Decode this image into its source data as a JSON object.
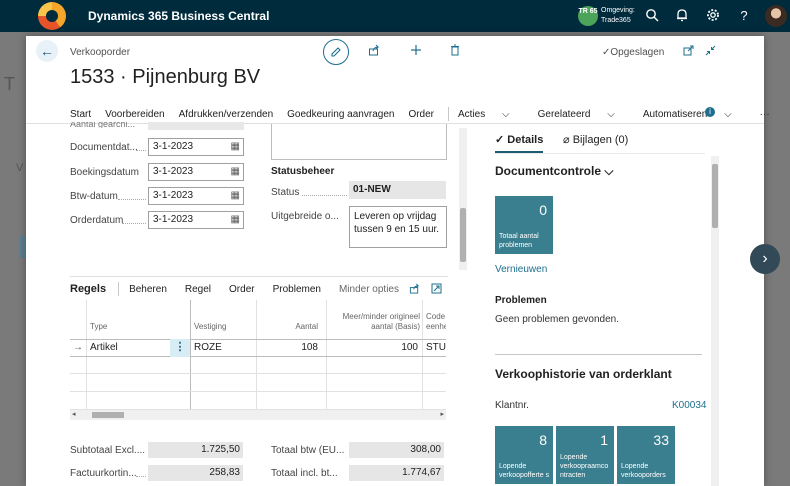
{
  "app": {
    "title": "Dynamics 365 Business Central",
    "env_badge": "TR 65",
    "env_label": "Omgeving:",
    "env_name": "Trade365"
  },
  "background": {
    "title_letter": "T",
    "side_letter": "V"
  },
  "page": {
    "breadcrumb": "Verkooporder",
    "title": "1533 · Pijnenburg BV",
    "saved": "Opgeslagen"
  },
  "actions": {
    "start": "Start",
    "prepare": "Voorbereiden",
    "print": "Afdrukken/verzenden",
    "approval": "Goedkeuring aanvragen",
    "order": "Order",
    "acts": "Acties",
    "related": "Gerelateerd",
    "automate": "Automatiseren",
    "more": "···"
  },
  "form": {
    "ghost_label": "Aantal gearchi...",
    "doc_date_label": "Documentdat...",
    "doc_date": "3-1-2023",
    "posting_date_label": "Boekingsdatum",
    "posting_date": "3-1-2023",
    "vat_date_label": "Btw-datum",
    "vat_date": "3-1-2023",
    "order_date_label": "Orderdatum",
    "order_date": "3-1-2023",
    "status_section": "Statusbeheer",
    "status_label": "Status",
    "status_value": "01-NEW",
    "ext_label": "Uitgebreide o...",
    "ext_value": "Leveren op vrijdag tussen 9 en 15 uur."
  },
  "lines": {
    "title": "Regels",
    "manage": "Beheren",
    "line": "Regel",
    "order": "Order",
    "problems": "Problemen",
    "fewer": "Minder opties",
    "headers": {
      "type": "Type",
      "location": "Vestiging",
      "qty": "Aantal",
      "more_less": "Meer/minder origineel aantal (Basis)",
      "uom": "Code eenhe"
    },
    "row": {
      "type": "Artikel",
      "location": "ROZE",
      "qty": "108",
      "more_less": "100",
      "uom": "STUK"
    }
  },
  "totals": {
    "subtotal_label": "Subtotaal Excl....",
    "subtotal": "1.725,50",
    "vat_total_label": "Totaal btw (EU...",
    "vat_total": "308,00",
    "invoice_discount_label": "Factuurkortin...",
    "invoice_discount": "258,83",
    "total_incl_label": "Totaal incl. bt...",
    "total_incl": "1.774,67"
  },
  "factbox": {
    "tab_details": "Details",
    "tab_attachments": "Bijlagen (0)",
    "doc_check": "Documentcontrole",
    "tile_count": "0",
    "tile_label": "Totaal aantal problemen",
    "refresh": "Vernieuwen",
    "problems_head": "Problemen",
    "problems_text": "Geen problemen gevonden.",
    "history_head": "Verkoophistorie van orderklant",
    "customer_label": "Klantnr.",
    "customer_no": "K00034",
    "tiles": [
      {
        "num": "8",
        "label": "Lopende verkoopofferte s"
      },
      {
        "num": "1",
        "label": "Lopende verkoopraamco ntracten"
      },
      {
        "num": "33",
        "label": "Lopende verkooporders"
      }
    ]
  }
}
